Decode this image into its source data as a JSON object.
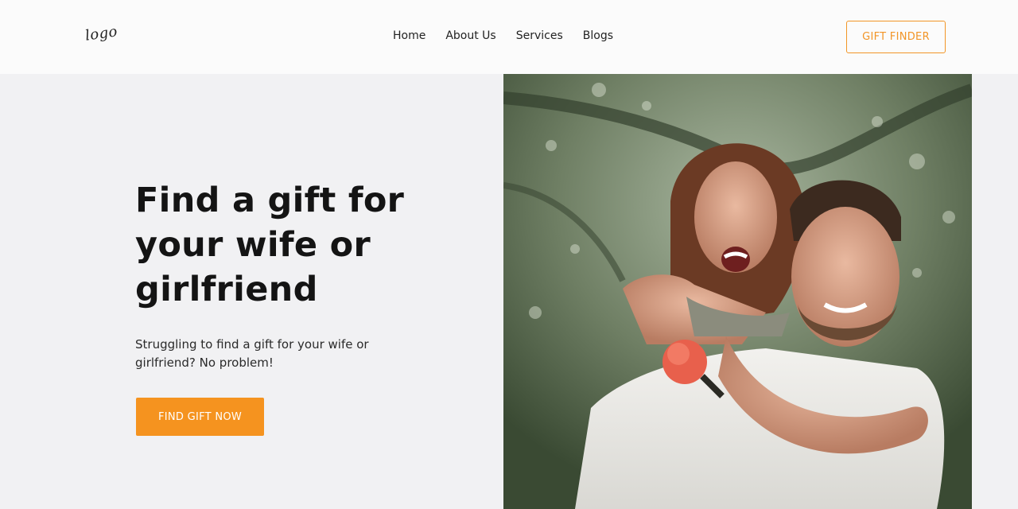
{
  "header": {
    "logo_text": "logo",
    "nav": [
      {
        "label": "Home"
      },
      {
        "label": "About Us"
      },
      {
        "label": "Services"
      },
      {
        "label": "Blogs"
      }
    ],
    "gift_finder_label": "GIFT FINDER"
  },
  "hero": {
    "title": "Find a gift for your wife or girlfriend",
    "subtitle": "Struggling to find a gift for your wife or girlfriend? No problem!",
    "cta_label": "FIND GIFT NOW"
  },
  "colors": {
    "accent": "#f5931f",
    "background": "#f1f1f3",
    "header_background": "#fbfbfb"
  },
  "image": {
    "icon": "couple-photo"
  }
}
